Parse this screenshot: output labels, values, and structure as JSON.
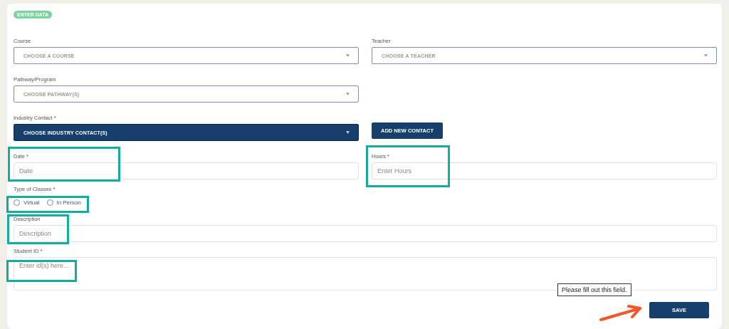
{
  "badge": "ENTER DATA",
  "rows": [
    {
      "cells": [
        {
          "kind": "select",
          "label": "Course",
          "placeholder": "CHOOSE A COURSE"
        },
        {
          "kind": "select",
          "label": "Teacher",
          "placeholder": "CHOOSE A TEACHER"
        }
      ]
    },
    {
      "cells": [
        {
          "kind": "select",
          "label": "Pathway/Program",
          "placeholder": "CHOOSE PATHWAY(S)"
        }
      ]
    },
    {
      "cells": [
        {
          "kind": "select-dark",
          "label": "Industry Contact *",
          "placeholder": "CHOOSE INDUSTRY CONTACT(S)"
        },
        {
          "kind": "button",
          "label": "ADD NEW CONTACT"
        }
      ]
    },
    {
      "cells": [
        {
          "kind": "input",
          "label": "Date *",
          "placeholder": "Date",
          "highlighted": true
        },
        {
          "kind": "input",
          "label": "Hours *",
          "placeholder": "Enter Hours",
          "highlighted": true
        }
      ]
    },
    {
      "cells": [
        {
          "kind": "radio",
          "label": "Type of Classes *",
          "options": [
            {
              "label": "Virtual",
              "selected": false
            },
            {
              "label": "In Person",
              "selected": false
            }
          ],
          "highlighted": true
        }
      ]
    },
    {
      "cells": [
        {
          "kind": "input-wide",
          "label": "Description",
          "placeholder": "Description",
          "highlighted": true
        }
      ]
    },
    {
      "cells": [
        {
          "kind": "textarea",
          "label": "Student ID *",
          "placeholder": "Enter id(s) here...",
          "highlighted": true
        }
      ]
    }
  ],
  "tooltip": "Please fill out this field.",
  "save_button": {
    "label": "SAVE",
    "pointed_at": true
  }
}
